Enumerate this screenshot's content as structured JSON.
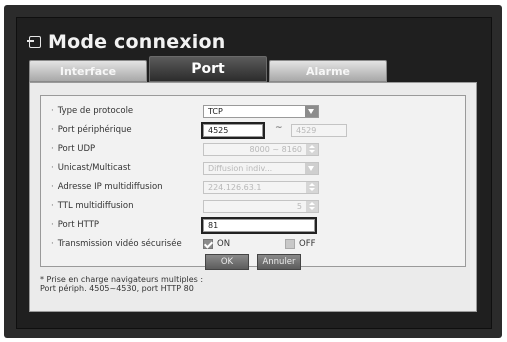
{
  "window": {
    "title": "Mode connexion"
  },
  "tabs": [
    {
      "label": "Interface",
      "active": false
    },
    {
      "label": "Port",
      "active": true
    },
    {
      "label": "Alarme",
      "active": false
    }
  ],
  "form": {
    "protocol_type": {
      "label": "Type de protocole",
      "value": "TCP"
    },
    "device_port": {
      "label": "Port périphérique",
      "value": "4525",
      "range_end": "4529",
      "separator": "~"
    },
    "udp_port": {
      "label": "Port UDP",
      "value": "8000 ~ 8160"
    },
    "unicast_multicast": {
      "label": "Unicast/Multicast",
      "value": "Diffusion indiv..."
    },
    "multicast_ip": {
      "label": "Adresse IP multidiffusion",
      "value": "224.126.63.1"
    },
    "multicast_ttl": {
      "label": "TTL multidiffusion",
      "value": "5"
    },
    "http_port": {
      "label": "Port HTTP",
      "value": "81"
    },
    "secure_video": {
      "label": "Transmission vidéo sécurisée",
      "on_label": "ON",
      "off_label": "OFF",
      "selected": "ON"
    }
  },
  "note": {
    "line1": "* Prise en charge navigateurs multiples :",
    "line2": "Port périph. 4505~4530, port HTTP 80"
  },
  "buttons": {
    "ok": "OK",
    "cancel": "Annuler"
  },
  "colors": {
    "frame": "#2b2b2b",
    "panel": "#ebebeb",
    "active_tab": "#3a3a3a",
    "checkbox": "#8c8c8c"
  }
}
